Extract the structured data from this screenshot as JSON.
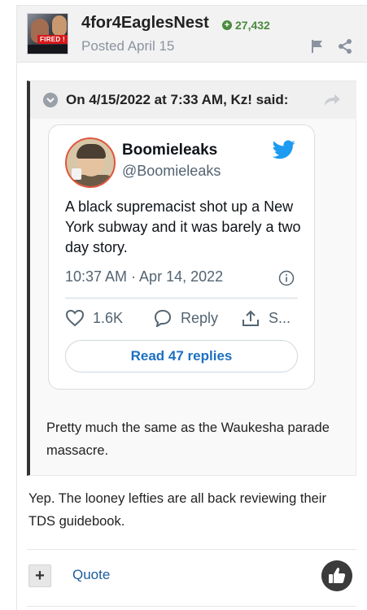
{
  "post": {
    "author": "4for4EaglesNest",
    "reputation": "27,432",
    "posted": "Posted April 15",
    "avatar_caption": "FIRED !",
    "quote": {
      "citation": "On 4/15/2022 at 7:33 AM, Kz! said:",
      "tweet": {
        "name": "Boomieleaks",
        "handle": "@Boomieleaks",
        "text": "A black supremacist shot up a New York subway and it was barely a two day story.",
        "timestamp": "10:37 AM · Apr 14, 2022",
        "likes": "1.6K",
        "reply_label": "Reply",
        "share_label": "S...",
        "read_replies": "Read 47 replies"
      },
      "body": "Pretty much the same as the Waukesha parade massacre."
    },
    "body": "Yep.  The looney lefties are all back reviewing their TDS guidebook.",
    "footer": {
      "multiquote_label": "+",
      "quote_label": "Quote"
    }
  },
  "colors": {
    "reputation": "#4a8a3d",
    "twitter_blue": "#1d9bf0",
    "link": "#1d5d9b"
  }
}
